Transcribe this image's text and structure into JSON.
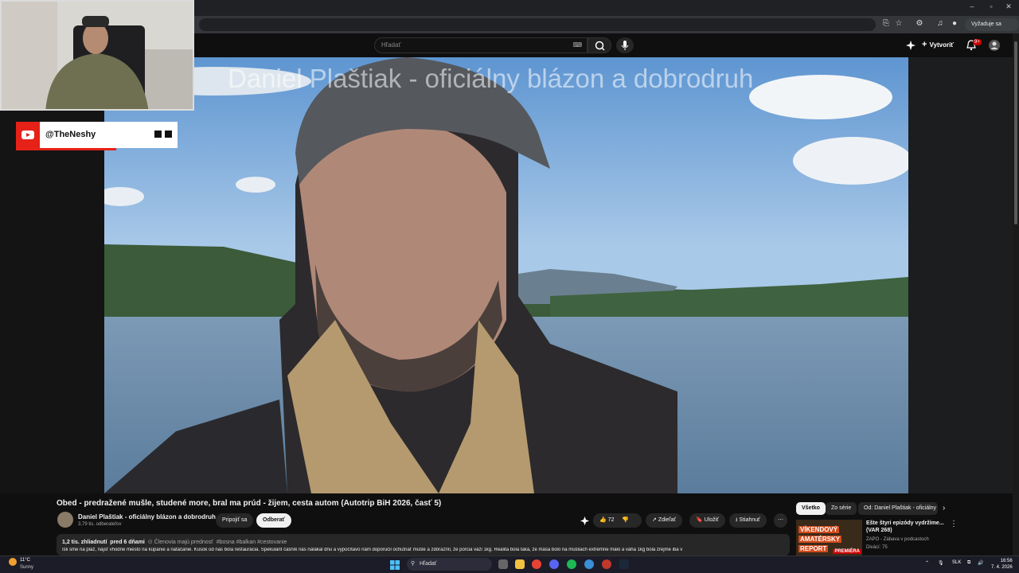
{
  "browser": {
    "window_controls": [
      "–",
      "▫",
      "✕"
    ],
    "update_button": "Vyžaduje sa akcia"
  },
  "header": {
    "search_placeholder": "Hľadať",
    "create_label": "Vytvoriť",
    "notifications_badge": "9+"
  },
  "video": {
    "overlay_title": "Daniel Plaštiak - oficiálny blázon a dobrodruh"
  },
  "overlay": {
    "handle": "@TheNeshy"
  },
  "watch": {
    "title": "Obed - predražené mušle, studené more, bral ma prúd - žijem, cesta autom (Autotrip BiH 2026, časť 5)",
    "channel_name": "Daniel Plaštiak - oficiálny blázon a dobrodruh",
    "subscribers": "3,79 tis. odberateľov",
    "join_label": "Pripojiť sa",
    "subscribe_label": "Odberať",
    "like_count": "72",
    "share_label": "Zdieľať",
    "save_label": "Uložiť",
    "download_label": "Stiahnuť",
    "views": "1,2 tis. zhliadnutí",
    "date": "pred 6 dňami",
    "members_note": "Členovia majú prednosť",
    "tags": "#bosna #balkan #cestovanie",
    "description": "Išli sme na pláž, nájsť vhodné miesto na kúpanie a natáčanie. Kúsok od nás bola reštaurácia. Špekulant čašník nás nalákal dnu a vypočítavo nám doporučil ochutnať mušle a zdôrazníl, že porcia váži 1kg. Realita bola taká, že mäsa bolo na mušliach extrémne málo a váha 1kg bola zrejme iba v"
  },
  "sidebar": {
    "chips": [
      "Všetko",
      "Zo série",
      "Od: Daniel Plaštiak - oficiálny"
    ],
    "recommendation": {
      "thumb_lines": [
        "VÍKENDOVÝ",
        "AMATÉRSKY",
        "REPORT"
      ],
      "thumb_badge": "PREMIÉRA",
      "title": "Ešte štyri epizódy vydržíme... (VAR 268)",
      "channel": "ZAPO - Zábava v podcastoch",
      "views": "Divácí: 75"
    }
  },
  "taskbar": {
    "weather_temp": "11°C",
    "weather_desc": "Sunny",
    "search_label": "Hľadať",
    "language": "SLK",
    "time": "16:56",
    "date": "7. 4. 2026"
  }
}
